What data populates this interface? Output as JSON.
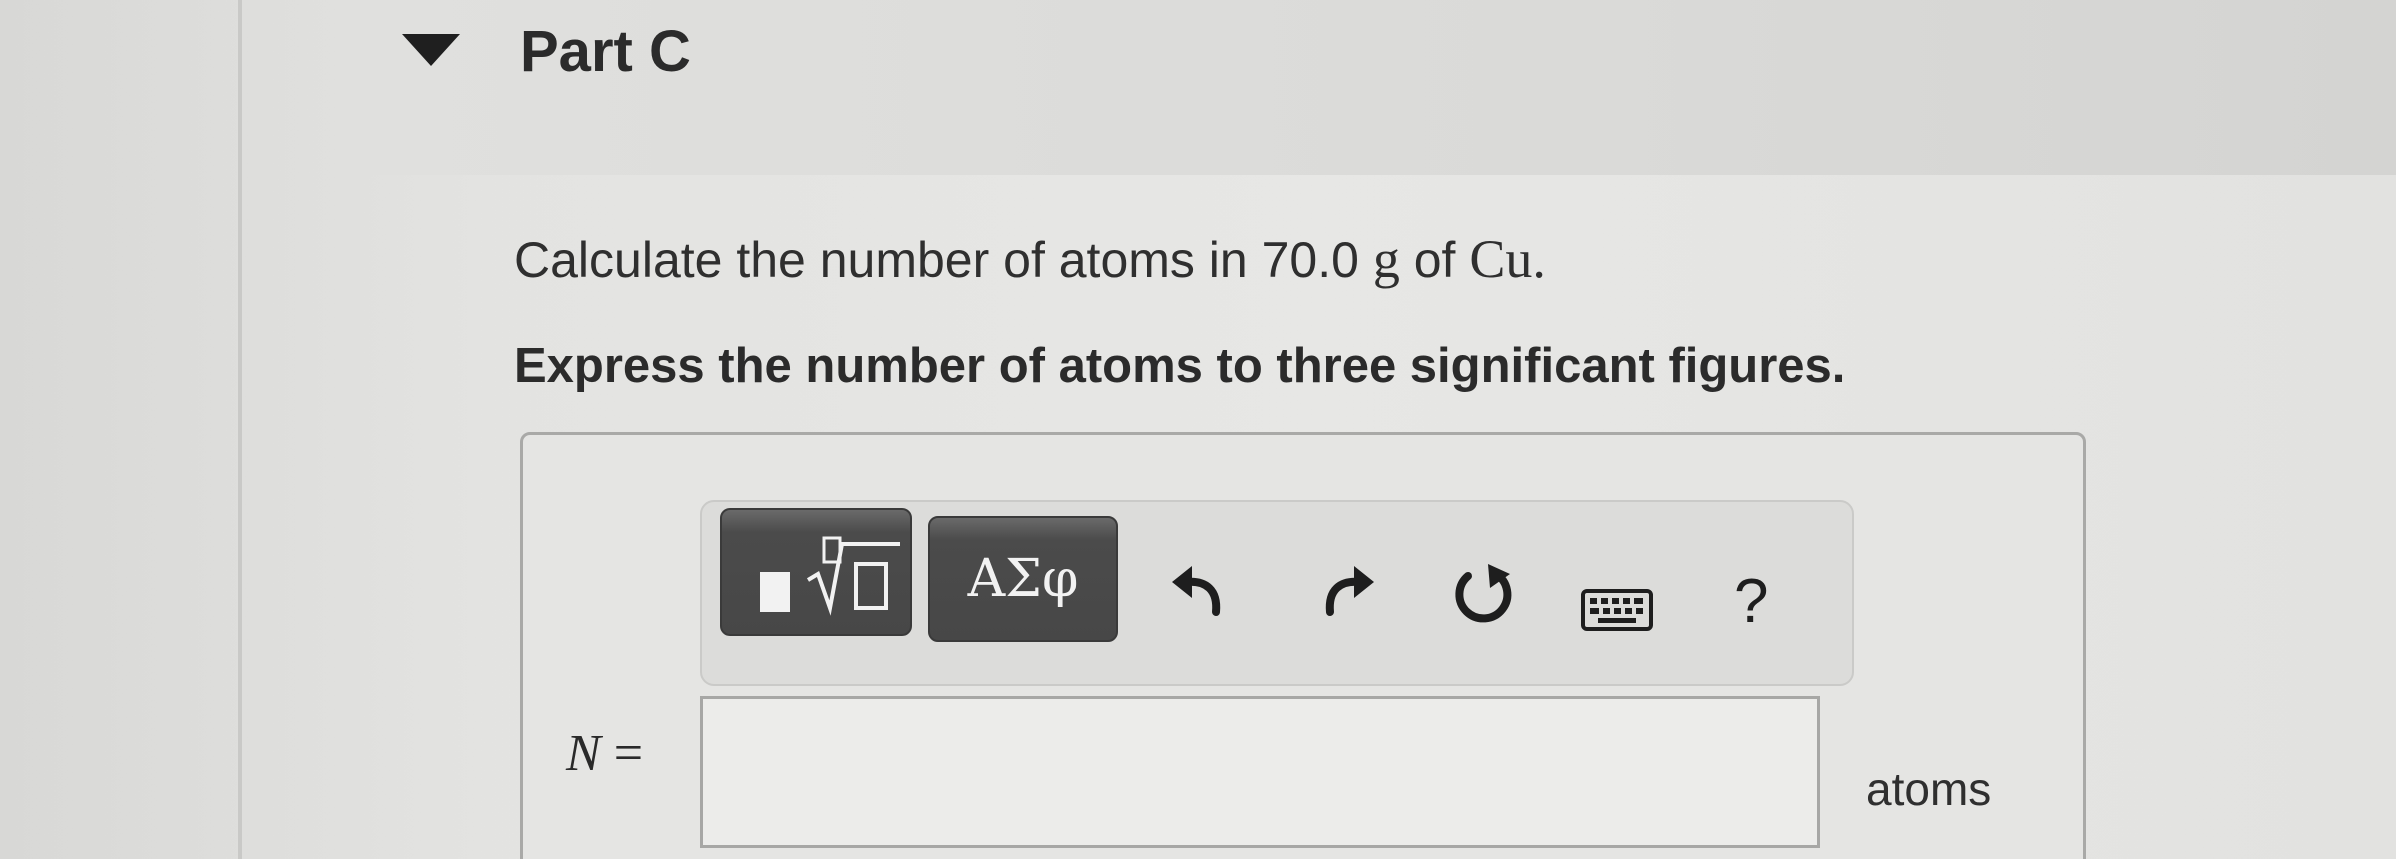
{
  "part": {
    "title": "Part C",
    "toggle_icon": "caret-down-icon"
  },
  "question": {
    "prefix": "Calculate the number of atoms in ",
    "quantity": "70.0",
    "unit": "g",
    "middle": " of ",
    "element": "Cu",
    "suffix": "."
  },
  "instruction": "Express the number of atoms to three significant figures.",
  "toolbar": {
    "templates_icon": "templates-icon",
    "greek_label": "ΑΣφ",
    "undo_icon": "undo-icon",
    "redo_icon": "redo-icon",
    "reset_icon": "reset-icon",
    "keyboard_icon": "keyboard-icon",
    "help_label": "?"
  },
  "answer": {
    "variable": "N",
    "equals": " =",
    "value": "",
    "unit": "atoms"
  },
  "colors": {
    "page_background": "#e5e5e3",
    "toolbar_button": "#4b4b4b",
    "text": "#2a2a2a"
  }
}
